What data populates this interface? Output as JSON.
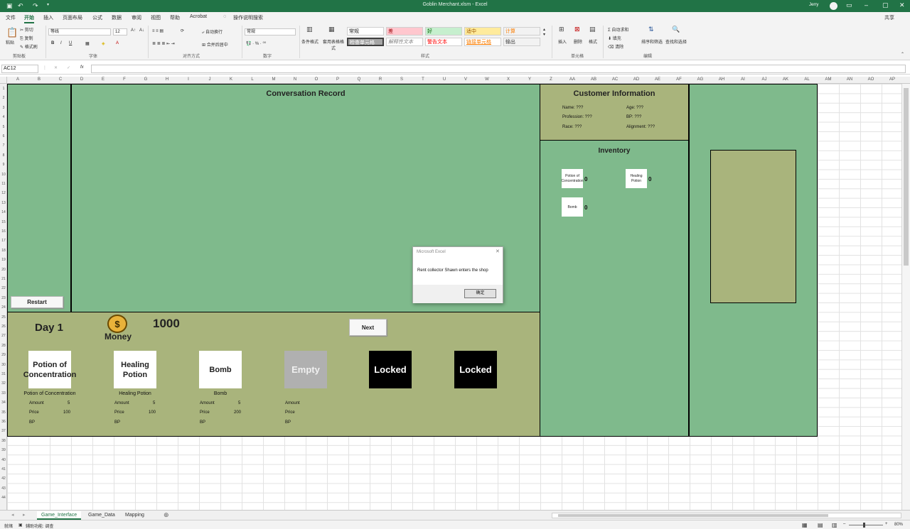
{
  "titlebar": {
    "title": "Goblin Merchant.xlsm  -  Excel",
    "user": "Jerry"
  },
  "menu": [
    "文件",
    "开始",
    "插入",
    "页面布局",
    "公式",
    "数据",
    "审阅",
    "视图",
    "帮助",
    "Acrobat",
    "操作说明搜索"
  ],
  "share": "共享",
  "ribbon": {
    "clipboard": {
      "paste": "粘贴",
      "cut": "剪切",
      "copy": "复制",
      "format_painter": "格式刷",
      "group": "剪贴板"
    },
    "font": {
      "name": "等线",
      "size": "12",
      "group": "字体"
    },
    "alignment": {
      "wrap": "自动换行",
      "merge": "合并后居中",
      "group": "对齐方式"
    },
    "number": {
      "format": "常规",
      "group": "数字"
    },
    "styles": {
      "conditional": "条件格式",
      "table": "套用表格格式",
      "cells": [
        "常规",
        "差",
        "好",
        "适中",
        "计算",
        "检查单元格",
        "解释性文本",
        "警告文本",
        "链接单元格",
        "输出"
      ],
      "group": "样式"
    },
    "cells_group": {
      "insert": "插入",
      "delete": "删除",
      "format": "格式",
      "group": "单元格"
    },
    "editing": {
      "autosum": "自动求和",
      "fill": "填充",
      "clear": "清除",
      "sort": "排序和筛选",
      "find": "查找和选择",
      "group": "编辑"
    }
  },
  "formula": {
    "namebox": "AC12",
    "fx": "fx",
    "value": ""
  },
  "columns": [
    "A",
    "B",
    "C",
    "D",
    "E",
    "F",
    "G",
    "H",
    "I",
    "J",
    "K",
    "L",
    "M",
    "N",
    "O",
    "P",
    "Q",
    "R",
    "S",
    "T",
    "U",
    "V",
    "W",
    "X",
    "Y",
    "Z",
    "AA",
    "AB",
    "AC",
    "AD",
    "AE",
    "AF",
    "AG",
    "AH",
    "AI",
    "AJ",
    "AK",
    "AL",
    "AM",
    "AN",
    "AO",
    "AP"
  ],
  "game": {
    "conversation_title": "Conversation Record",
    "customer_title": "Customer Information",
    "customer": {
      "name": "Name: ???",
      "age": "Age: ???",
      "profession": "Profession: ???",
      "bp": "BP: ???",
      "race": "Race: ???",
      "alignment": "Alignment: ???"
    },
    "inventory_title": "Inventory",
    "inventory": [
      {
        "label": "Potion of Concentration",
        "count": "0"
      },
      {
        "label": "Healing Potion",
        "count": "0"
      },
      {
        "label": "Bomb",
        "count": "0"
      }
    ],
    "restart": "Restart",
    "day": "Day 1",
    "money_label": "Money",
    "money_value": "1000",
    "next": "Next",
    "shop": [
      {
        "card": "Potion of Concentration",
        "name": "Potion of Concentration",
        "amount": "5",
        "price": "100",
        "bp": ""
      },
      {
        "card": "Healing Potion",
        "name": "Healing Potion",
        "amount": "5",
        "price": "100",
        "bp": ""
      },
      {
        "card": "Bomb",
        "name": "Bomb",
        "amount": "5",
        "price": "200",
        "bp": ""
      },
      {
        "card": "Empty",
        "name": "",
        "amount": "",
        "price": "",
        "bp": ""
      },
      {
        "card": "Locked"
      },
      {
        "card": "Locked"
      }
    ],
    "labels": {
      "amount": "Amount",
      "price": "Price",
      "bp": "BP"
    }
  },
  "dialog": {
    "title": "Microsoft Excel",
    "message": "Rent collector Shawn enters the shop",
    "ok": "确定"
  },
  "sheets": [
    "Game_Interface",
    "Game_Data",
    "Mapping"
  ],
  "status": {
    "ready": "就绪",
    "accessibility": "辅助功能: 调查",
    "zoom": "80%"
  },
  "colors": {
    "excel_green": "#217346",
    "olive": "#a9b47c",
    "green_panel": "#7fba8c",
    "locked": "#000000",
    "empty": "#b0b0b0"
  }
}
